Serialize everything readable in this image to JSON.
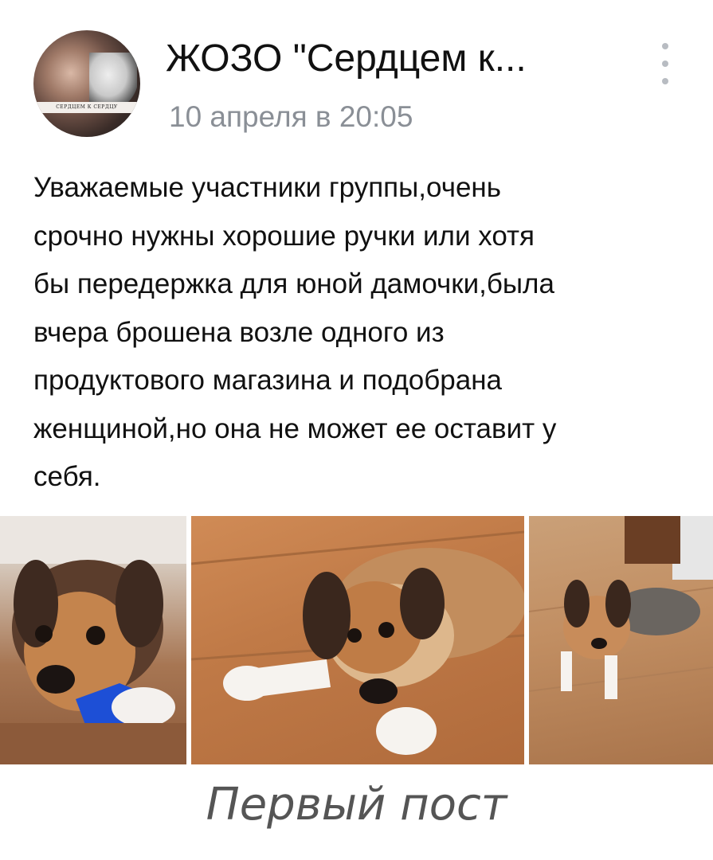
{
  "post": {
    "group_name": "ЖОЗО \"Сердцем к...",
    "avatar_banner_text": "СЕРДЦЕМ К СЕРДЦУ",
    "date": "10 апреля в 20:05",
    "text": "Уважаемые участники группы,очень\nсрочно нужны хорошие ручки или хотя\nбы передержка для юной дамочки,была\nвчера брошена возле одного из\nпродуктового магазина и подобрана\nженщиной,но она не может ее оставит у\nсебя.",
    "more_icon": "vertical-dots-icon"
  },
  "caption": "Первый пост",
  "colors": {
    "date_gray": "#8a8f96",
    "menu_dots": "#b8bcc2"
  }
}
